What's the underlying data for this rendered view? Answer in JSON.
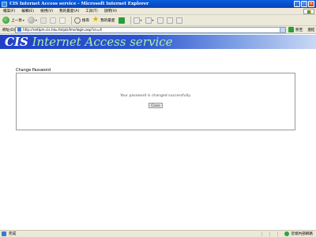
{
  "window": {
    "title": "CIS Internet Access service - Microsoft Internet Explorer",
    "minimize_glyph": "_",
    "maximize_glyph": "□",
    "close_glyph": "×"
  },
  "menu": {
    "items": [
      "檔案(F)",
      "編輯(E)",
      "檢視(V)",
      "我的最愛(A)",
      "工具(T)",
      "說明(H)"
    ]
  },
  "toolbar": {
    "back_label": "上一頁",
    "search_label": "搜尋",
    "favorites_label": "我的最愛"
  },
  "address": {
    "label": "網址(D)",
    "url": "http://netlpm.cis.hku.hk/pls/lms/login.asp?cn=4",
    "go_label": "移至",
    "links_label": "連結"
  },
  "banner": {
    "cis": "CIS",
    "rest": " Internet Access service"
  },
  "content": {
    "legend": "Change Password",
    "message": "Your password is changed successfully.",
    "close_label": "Close"
  },
  "status": {
    "text": "完成",
    "zone": "近端內部網路"
  }
}
